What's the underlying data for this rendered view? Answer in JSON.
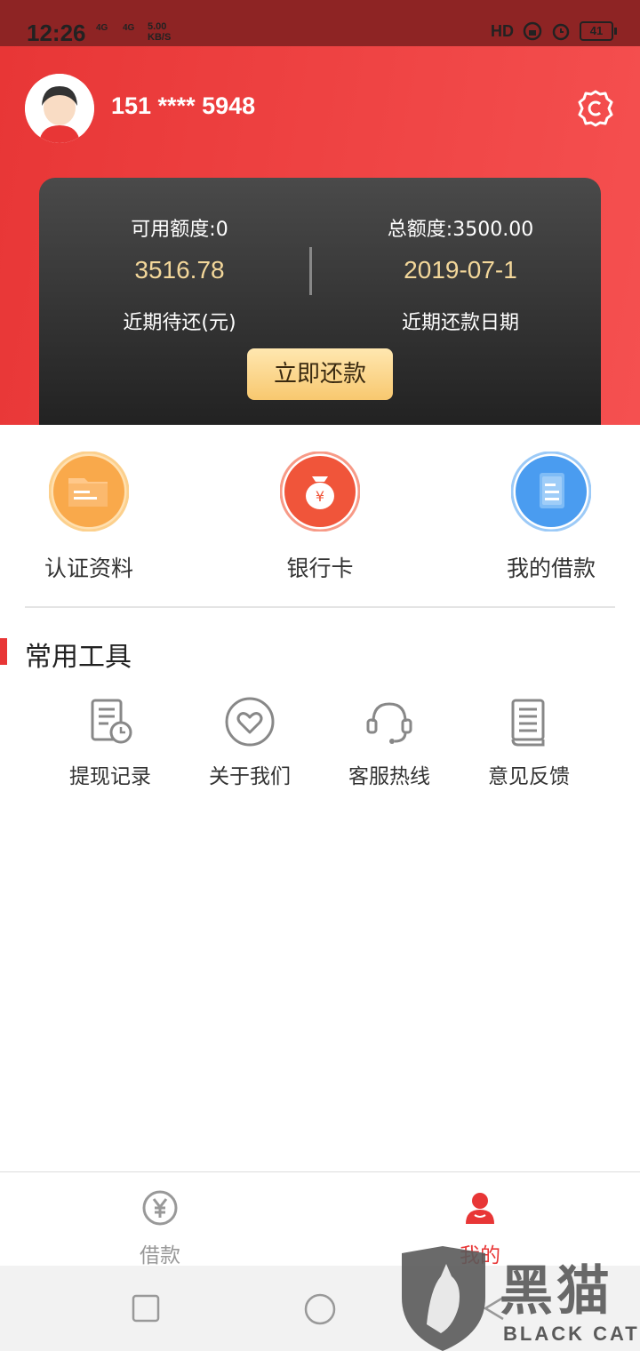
{
  "status_bar": {
    "time": "12:26",
    "signal1": "4G",
    "signal2": "4G",
    "speed_value": "5.00",
    "speed_unit": "KB/S",
    "hd_label": "HD",
    "battery": "41"
  },
  "profile": {
    "phone": "151 **** 5948"
  },
  "card": {
    "available_label": "可用额度:0",
    "total_label": "总额度:3500.00",
    "due_amount": "3516.78",
    "due_date": "2019-07-1",
    "due_amount_caption": "近期待还(元)",
    "due_date_caption": "近期还款日期",
    "repay_button": "立即还款"
  },
  "quick_actions": [
    {
      "label": "认证资料",
      "icon": "folder-icon",
      "color": "#f9a94b"
    },
    {
      "label": "银行卡",
      "icon": "money-bag-icon",
      "color": "#f0553a"
    },
    {
      "label": "我的借款",
      "icon": "document-icon",
      "color": "#4a9cf0"
    }
  ],
  "tools": {
    "title": "常用工具",
    "items": [
      {
        "label": "提现记录",
        "icon": "record-clock-icon"
      },
      {
        "label": "关于我们",
        "icon": "heart-icon"
      },
      {
        "label": "客服热线",
        "icon": "headset-icon"
      },
      {
        "label": "意见反馈",
        "icon": "book-icon"
      }
    ]
  },
  "bottom_nav": {
    "items": [
      {
        "label": "借款",
        "icon": "yen-icon",
        "active": false
      },
      {
        "label": "我的",
        "icon": "user-icon",
        "active": true
      }
    ],
    "active_color": "#e83636",
    "inactive_color": "#999999"
  },
  "watermark": {
    "cn": "黑猫",
    "en": "BLACK CAT"
  }
}
